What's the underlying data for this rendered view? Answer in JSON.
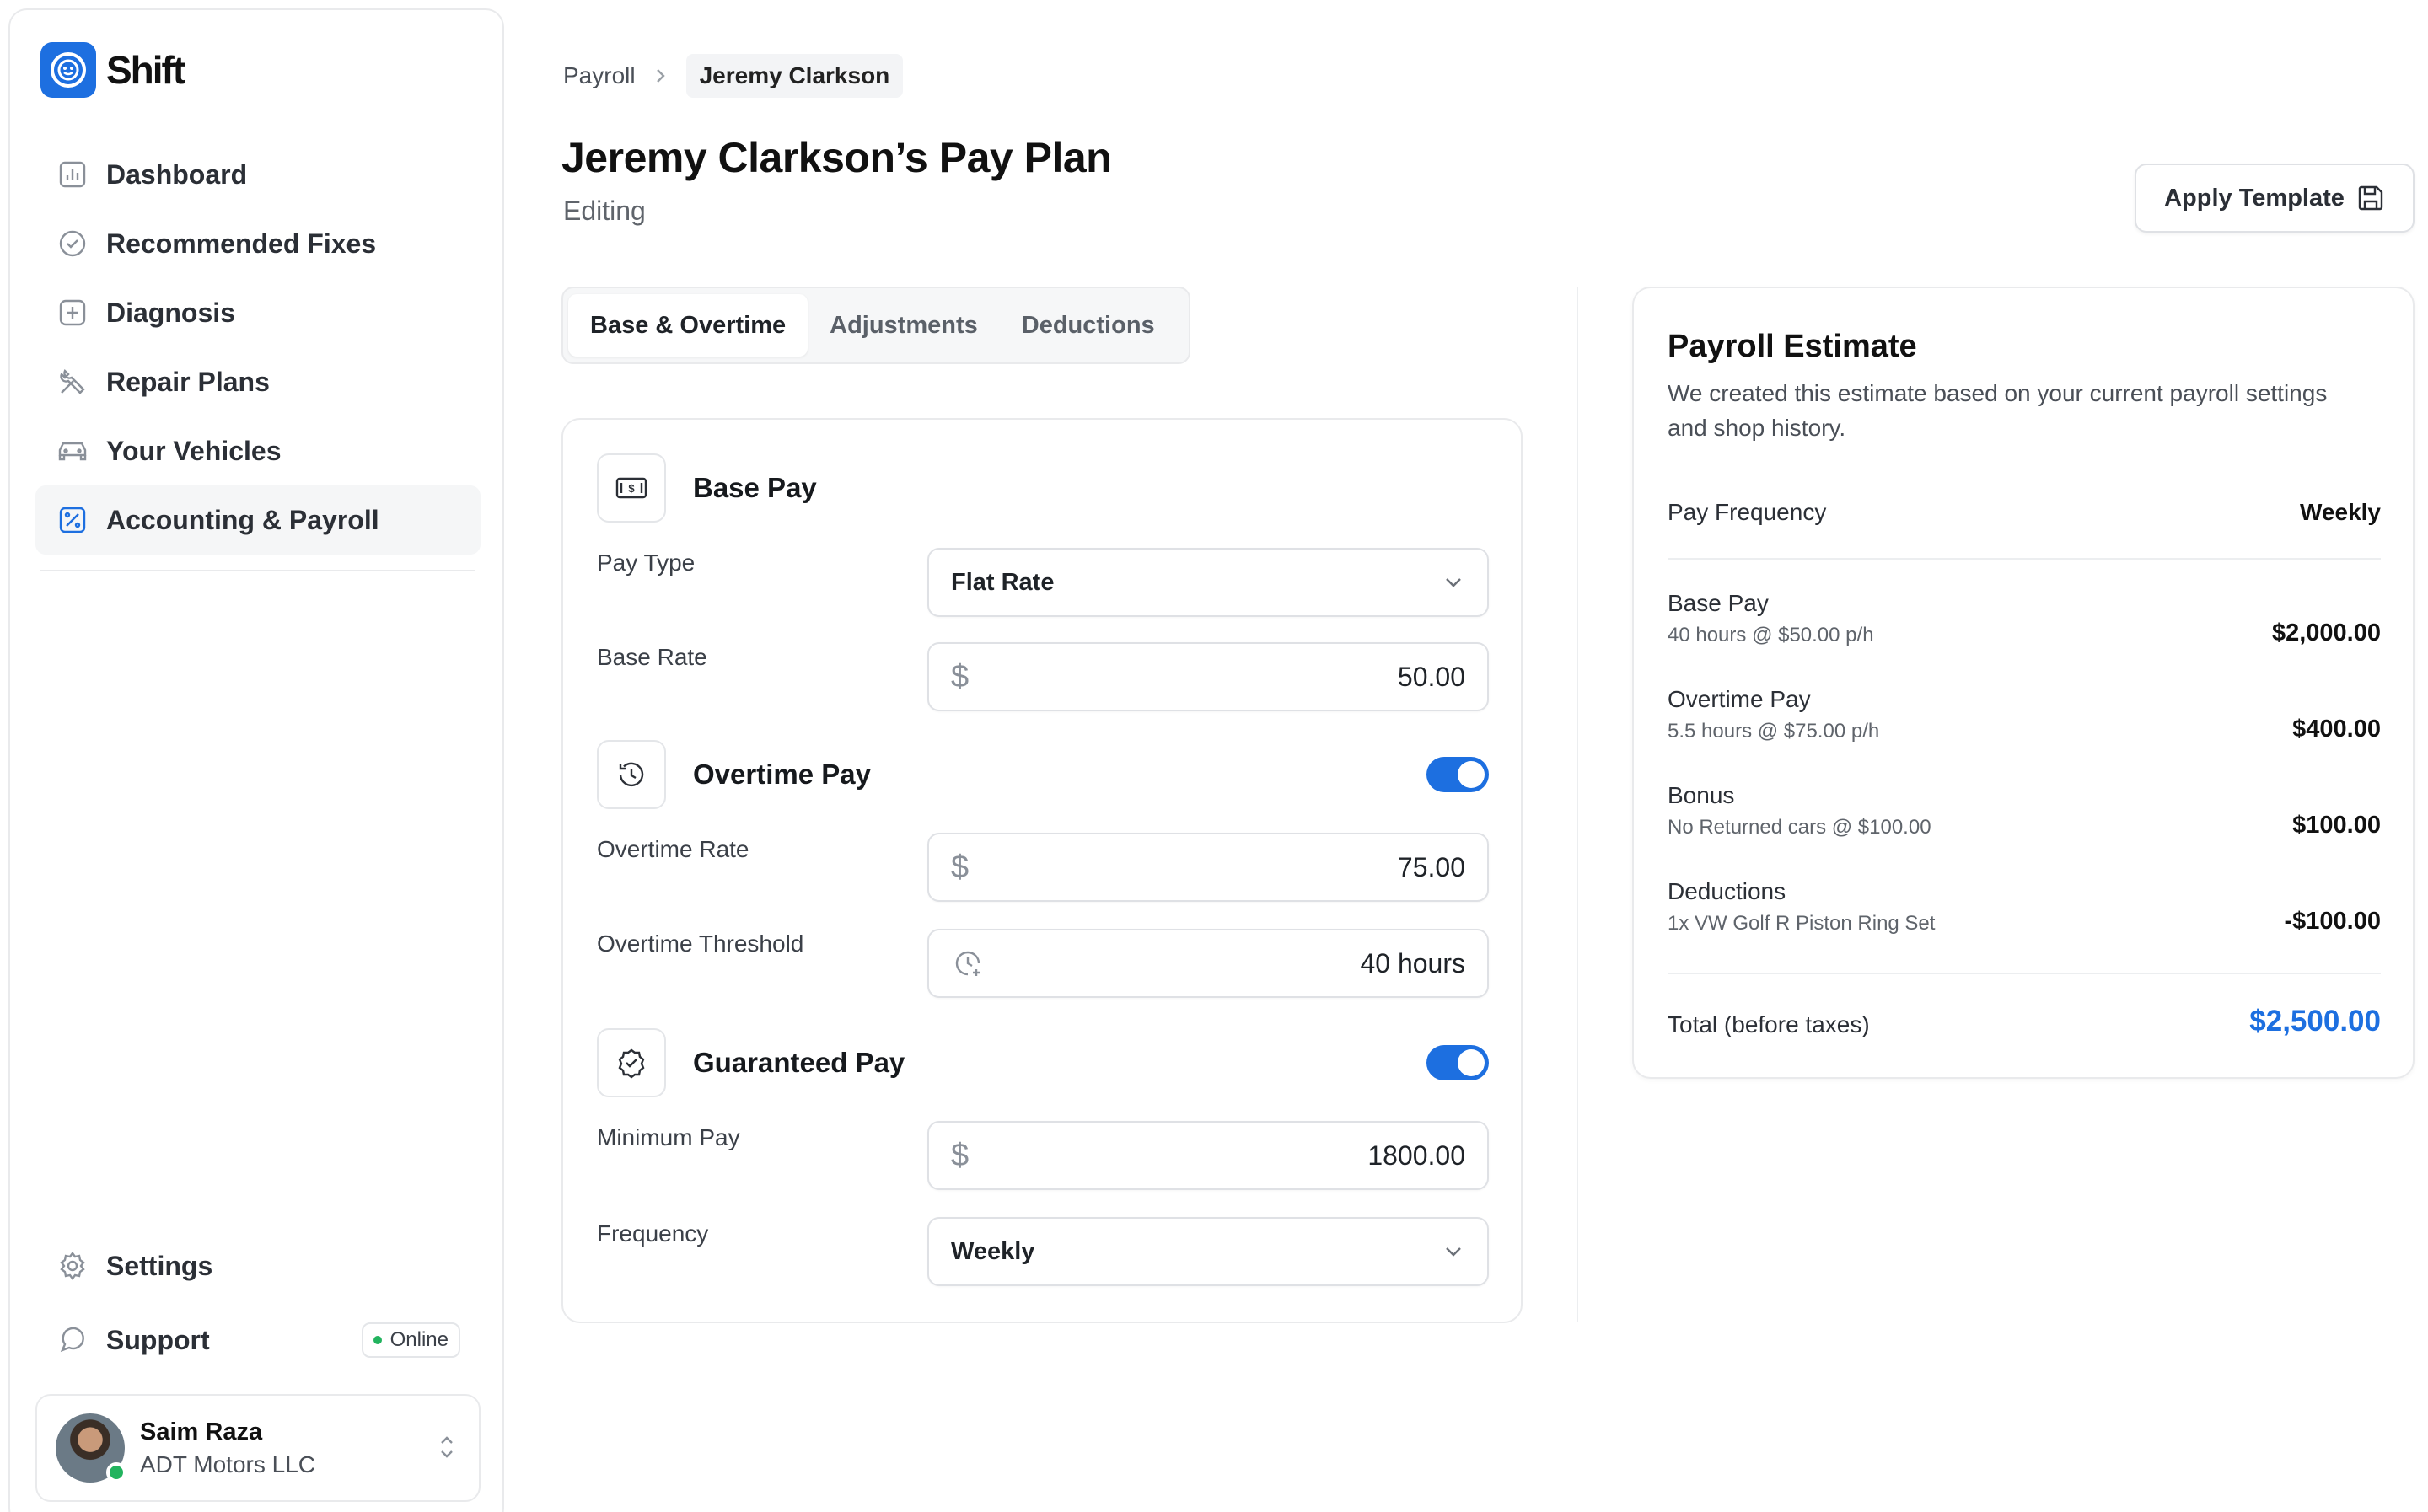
{
  "app": {
    "name": "Shift"
  },
  "sidebar": {
    "items": [
      {
        "label": "Dashboard",
        "icon": "chart-icon"
      },
      {
        "label": "Recommended Fixes",
        "icon": "check-circle-icon"
      },
      {
        "label": "Diagnosis",
        "icon": "plus-square-icon"
      },
      {
        "label": "Repair Plans",
        "icon": "tools-icon"
      },
      {
        "label": "Your Vehicles",
        "icon": "car-icon"
      },
      {
        "label": "Accounting & Payroll",
        "icon": "percent-square-icon",
        "active": true
      }
    ],
    "bottom": [
      {
        "label": "Settings",
        "icon": "gear-icon"
      },
      {
        "label": "Support",
        "icon": "chat-icon",
        "badge": "Online"
      }
    ],
    "user": {
      "name": "Saim Raza",
      "org": "ADT Motors LLC",
      "status_color": "#22b35e"
    }
  },
  "breadcrumb": {
    "parent": "Payroll",
    "current": "Jeremy Clarkson"
  },
  "page": {
    "title": "Jeremy Clarkson’s Pay Plan",
    "subtitle": "Editing"
  },
  "actions": {
    "apply_template": "Apply Template"
  },
  "tabs": [
    {
      "label": "Base & Overtime",
      "active": true
    },
    {
      "label": "Adjustments"
    },
    {
      "label": "Deductions"
    }
  ],
  "form": {
    "base_pay": {
      "title": "Base Pay",
      "pay_type_label": "Pay Type",
      "pay_type_value": "Flat Rate",
      "base_rate_label": "Base Rate",
      "base_rate_value": "50.00"
    },
    "overtime": {
      "title": "Overtime Pay",
      "enabled": true,
      "rate_label": "Overtime Rate",
      "rate_value": "75.00",
      "threshold_label": "Overtime Threshold",
      "threshold_value": "40 hours"
    },
    "guaranteed": {
      "title": "Guaranteed Pay",
      "enabled": true,
      "minimum_label": "Minimum Pay",
      "minimum_value": "1800.00",
      "frequency_label": "Frequency",
      "frequency_value": "Weekly"
    },
    "currency_symbol": "$"
  },
  "estimate": {
    "title": "Payroll Estimate",
    "description": "We created this estimate based on your current payroll settings and shop history.",
    "frequency_label": "Pay Frequency",
    "frequency_value": "Weekly",
    "rows": [
      {
        "label": "Base Pay",
        "sub": "40 hours @ $50.00 p/h",
        "amount": "$2,000.00"
      },
      {
        "label": "Overtime Pay",
        "sub": "5.5 hours @ $75.00 p/h",
        "amount": "$400.00"
      },
      {
        "label": "Bonus",
        "sub": "No Returned cars @ $100.00",
        "amount": "$100.00"
      },
      {
        "label": "Deductions",
        "sub": "1x VW Golf R Piston Ring Set",
        "amount": "-$100.00"
      }
    ],
    "total_label": "Total (before taxes)",
    "total_value": "$2,500.00"
  },
  "colors": {
    "accent": "#1d6fe0",
    "online": "#22b35e"
  }
}
